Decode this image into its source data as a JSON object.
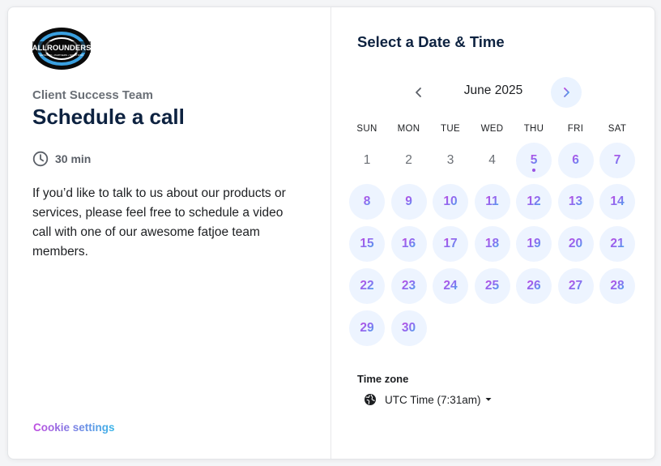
{
  "brand": {
    "logo_text": "ALLROUNDERS",
    "logo_tagline": "NETWORK • PARTNERS • SOLUTIONS"
  },
  "event": {
    "team": "Client Success Team",
    "title": "Schedule a call",
    "duration": "30 min",
    "description": "If you’d like to talk to us about our products or services, please feel free to schedule a video call with one of our awesome fatjoe team members."
  },
  "footer": {
    "cookie_label": "Cookie settings"
  },
  "calendar": {
    "heading": "Select a Date & Time",
    "month_label": "June 2025",
    "weekdays": [
      "SUN",
      "MON",
      "TUE",
      "WED",
      "THU",
      "FRI",
      "SAT"
    ],
    "first_weekday_index": 0,
    "days": [
      {
        "d": "1",
        "available": false
      },
      {
        "d": "2",
        "available": false
      },
      {
        "d": "3",
        "available": false
      },
      {
        "d": "4",
        "available": false
      },
      {
        "d": "5",
        "available": true,
        "today": true
      },
      {
        "d": "6",
        "available": true
      },
      {
        "d": "7",
        "available": true
      },
      {
        "d": "8",
        "available": true
      },
      {
        "d": "9",
        "available": true
      },
      {
        "d": "10",
        "available": true
      },
      {
        "d": "11",
        "available": true
      },
      {
        "d": "12",
        "available": true
      },
      {
        "d": "13",
        "available": true
      },
      {
        "d": "14",
        "available": true
      },
      {
        "d": "15",
        "available": true
      },
      {
        "d": "16",
        "available": true
      },
      {
        "d": "17",
        "available": true
      },
      {
        "d": "18",
        "available": true
      },
      {
        "d": "19",
        "available": true
      },
      {
        "d": "20",
        "available": true
      },
      {
        "d": "21",
        "available": true
      },
      {
        "d": "22",
        "available": true
      },
      {
        "d": "23",
        "available": true
      },
      {
        "d": "24",
        "available": true
      },
      {
        "d": "25",
        "available": true
      },
      {
        "d": "26",
        "available": true
      },
      {
        "d": "27",
        "available": true
      },
      {
        "d": "28",
        "available": true
      },
      {
        "d": "29",
        "available": true
      },
      {
        "d": "30",
        "available": true
      }
    ]
  },
  "timezone": {
    "label": "Time zone",
    "value": "UTC Time (7:31am)"
  },
  "colors": {
    "accent_start": "#c145de",
    "accent_end": "#2fb8ea",
    "available_bg": "#edf4ff",
    "heading": "#0d2240"
  },
  "icons": {
    "clock": "clock-icon",
    "globe": "globe-icon",
    "prev": "chevron-left-icon",
    "next": "chevron-right-icon",
    "caret": "caret-down-icon"
  }
}
